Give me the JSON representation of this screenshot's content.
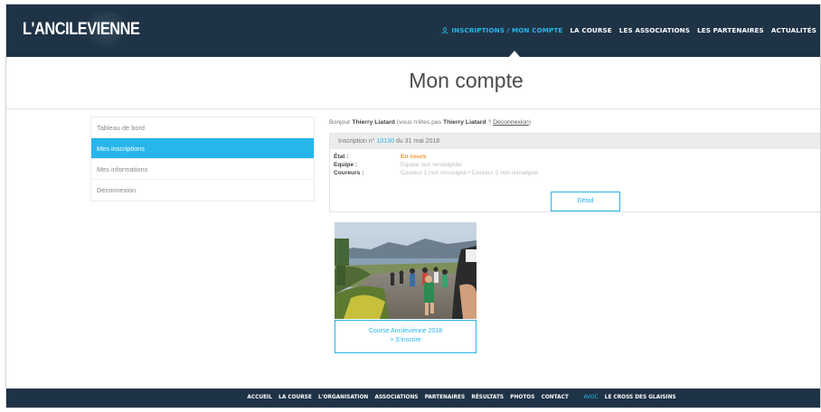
{
  "header": {
    "logo": "L'ANCILEVIENNE",
    "nav": [
      {
        "label": "INSCRIPTIONS / MON COMPTE",
        "active": true
      },
      {
        "label": "LA COURSE"
      },
      {
        "label": "LES ASSOCIATIONS"
      },
      {
        "label": "LES PARTENAIRES"
      },
      {
        "label": "ACTUALITÉS"
      }
    ]
  },
  "page": {
    "title": "Mon compte"
  },
  "sidebar": {
    "items": [
      {
        "label": "Tableau de bord"
      },
      {
        "label": "Mes inscriptions",
        "active": true
      },
      {
        "label": "Mes informations"
      },
      {
        "label": "Déconnexion"
      }
    ]
  },
  "greeting": {
    "prefix": "Bonjour ",
    "user": "Thierry Liatard",
    "middle": " (vous n'êtes pas ",
    "user2": "Thierry Liatard",
    "suffix": " ? ",
    "logout": "Déconnexion",
    "close": ")"
  },
  "order": {
    "prefix": "Inscription n° ",
    "number": "10130",
    "date": " du 31 mai 2018",
    "rows": [
      {
        "label": "État :",
        "value": "En cours"
      },
      {
        "label": "Equipe :",
        "value": "Equipe non renseignée"
      },
      {
        "label": "Coureurs :",
        "value": "Coureur 1 non renseigné • Coureur 2 non renseigné"
      }
    ],
    "detail": "Détail"
  },
  "product": {
    "line1": "Course Ancilevienne 2018",
    "line2": "> S'inscrire"
  },
  "footer": {
    "items": [
      {
        "label": "ACCUEIL"
      },
      {
        "label": "LA COURSE"
      },
      {
        "label": "L'ORGANISATION"
      },
      {
        "label": "ASSOCIATIONS"
      },
      {
        "label": "PARTENAIRES"
      },
      {
        "label": "RÉSULTATS"
      },
      {
        "label": "PHOTOS"
      },
      {
        "label": "CONTACT"
      },
      {
        "label": "AVOC",
        "accent": true
      },
      {
        "label": "LE CROSS DES GLAISINS"
      }
    ]
  },
  "colors": {
    "navy": "#1f3346",
    "accent": "#27b6e9",
    "status": "#f0932b"
  }
}
